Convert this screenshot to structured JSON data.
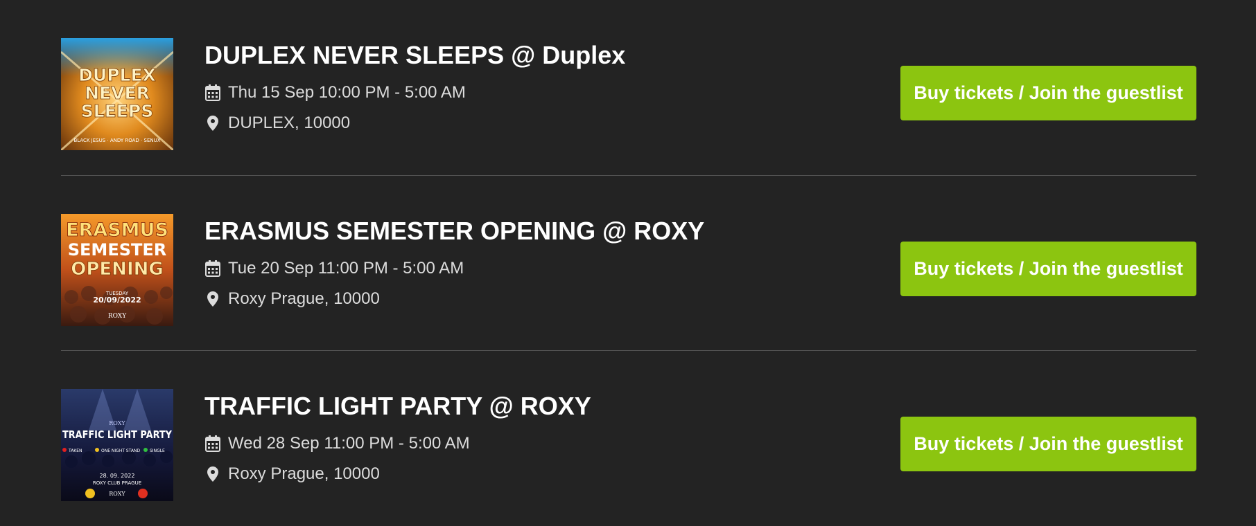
{
  "colors": {
    "background": "#232323",
    "accent_button": "#8cc510",
    "divider": "#555555"
  },
  "events": [
    {
      "title": "DUPLEX NEVER SLEEPS @ Duplex",
      "date": "Thu 15 Sep 10:00 PM - 5:00 AM",
      "location": "DUPLEX, 10000",
      "button_label": "Buy tickets / Join the guestlist",
      "poster": {
        "lines": [
          "DUPLEX",
          "NEVER",
          "SLEEPS"
        ],
        "footer": "BLACK JESUS · ANDY ROAD · SENUX"
      }
    },
    {
      "title": "ERASMUS SEMESTER OPENING @ ROXY",
      "date": "Tue 20 Sep 11:00 PM - 5:00 AM",
      "location": "Roxy Prague, 10000",
      "button_label": "Buy tickets / Join the guestlist",
      "poster": {
        "lines": [
          "ERASMUS",
          "SEMESTER",
          "OPENING"
        ],
        "day": "TUESDAY",
        "date": "20/09/2022",
        "logo": "ROXY"
      }
    },
    {
      "title": "TRAFFIC LIGHT PARTY @ ROXY",
      "date": "Wed 28 Sep 11:00 PM - 5:00 AM",
      "location": "Roxy Prague, 10000",
      "button_label": "Buy tickets / Join the guestlist",
      "poster": {
        "headline": "TRAFFIC LIGHT PARTY",
        "tags": [
          "TAKEN",
          "ONE NIGHT STAND",
          "SINGLE"
        ],
        "date": "28. 09. 2022",
        "venue": "ROXY CLUB PRAGUE",
        "logo": "ROXY"
      }
    }
  ],
  "icons": {
    "date": "calendar-icon",
    "location": "map-marker-icon"
  }
}
